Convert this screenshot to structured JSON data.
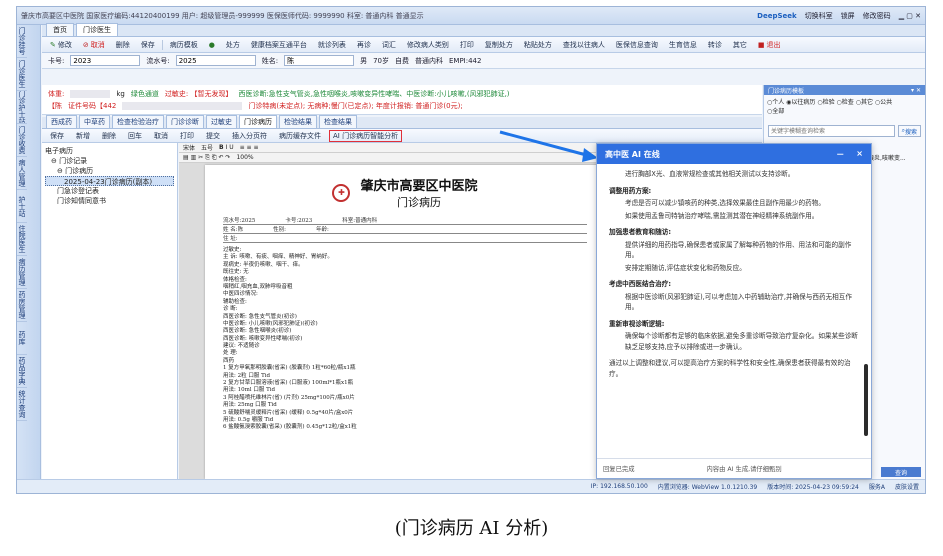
{
  "window": {
    "title": "肇庆市高要区中医院 国家医疗编码:44120400199 用户: 超级管理员-999999 医保医师代码: 9999990 科室: 普通内科  普通显示",
    "deepseek": "DeepSeek",
    "switch_dept": "切换科室",
    "lock": "锁屏",
    "change_pwd": "修改密码"
  },
  "left_rail": [
    "门诊挂号",
    "门诊医生",
    "门诊护士站",
    "门诊收费",
    "病人管理",
    "护士站",
    "住院医生",
    "病历管理",
    "药房管理",
    "药库",
    "药品字典",
    "统计查询"
  ],
  "top_tabs": [
    "首页",
    "门诊医生"
  ],
  "toolbar": [
    "修改",
    "取消",
    "删除",
    "保存",
    "病历模板",
    "保存",
    "处方",
    "健康档案互通平台",
    "就诊列表",
    "再诊",
    "词汇",
    "修改病人类别",
    "打印",
    "复制处方",
    "粘贴处方",
    "查找以往病人",
    "医保信息查询",
    "生育信息",
    "转诊",
    "其它",
    "退出"
  ],
  "row2": {
    "card_label": "卡号:",
    "card_value": "2023",
    "flow_label": "流水号:",
    "flow_value": "2025",
    "name_label": "姓名:",
    "name_value": "陈",
    "gender": "男",
    "age": "70岁",
    "fee_type": "自费",
    "category": "普通内科",
    "empi": "EMPI:442"
  },
  "info": {
    "weight_label": "体重:",
    "weight_unit": "kg",
    "green_channel": "绿色通道",
    "allergy": "过敏史: 【暂无发现】",
    "western_dx": "西医诊断:急性支气管炎,急性咽喉炎,咳嗽变异性哮喘、中医诊断:小儿咳嗽,(风邪犯肺证,)",
    "id_prefix": "【陈",
    "id_label": "证件号码【442",
    "special": "门诊特病(未定点); 无病种;慢门(已定点); 年度计报销: 普通门诊(0元);"
  },
  "subtabs": [
    "西成药",
    "中草药",
    "检查检验治疗",
    "门诊诊断",
    "过敏史",
    "门诊病历",
    "检验结果",
    "检查结果"
  ],
  "toolbar2": [
    "保存",
    "新增",
    "删除",
    "回车",
    "取消",
    "打印",
    "提交",
    "插入分页符",
    "病历缓存文件"
  ],
  "ai_button": "AI 门诊病历智能分析",
  "tree": [
    "电子病历",
    "门诊记录",
    "门诊病历",
    "2025-04-23门诊病历(副本)",
    "门急诊登记表",
    "门诊知情同意书"
  ],
  "editor": {
    "style": "宋体",
    "size": "五号",
    "zoom": "100%"
  },
  "paper": {
    "hospital": "肇庆市高要区中医院",
    "doc_title": "门诊病历",
    "flow_label": "流水号:2025",
    "card_label": "卡号:2023",
    "dept_label": "科室:普通内科",
    "name_label": "姓  名:陈",
    "gender_label": "性别:",
    "age_label": "年龄:",
    "addr_label": "住  址:",
    "lines": [
      "过敏史:",
      "主 诉: 咳嗽、有痰、咽痒、精神好、胃纳好。",
      "现病史: 半夜仍咳嗽、咽干、痒。",
      "既往史: 无",
      "体格检查:",
      "   咽稍红,咽充血,双肺呼吸音粗",
      "中医四诊情况:",
      "辅助检查:",
      "诊    断:",
      "   西医诊断: 急性支气管炎(初诊)",
      "   中医诊断: 小儿咳嗽(风邪犯肺证)(初诊)",
      "   西医诊断: 急性咽喉炎(初诊)",
      "   西医诊断: 咳嗽变异性哮喘(初诊)",
      "建议: 不适随诊",
      "处  理:",
      "      西药",
      "1 复方甲氧那明胶囊(省采) (胶囊剂) 1粒*60粒/瓶x1瓶",
      "   用法: 2粒 口服 Tid",
      "2 复方甘草口服溶液(省采) (口服液) 100ml*1瓶x1瓶",
      "   用法: 10ml 口服 Tid",
      "3 阿桂醋喷托维林片(省) (片剂) 25mg*100片/瓶x0片",
      "   用法: 25mg 口服 Tid",
      "5 硫酸舒喘灵缓释片(省采) (缓释) 0.5g*40片/盒x0片",
      "   用法: 0.5g 嚼服 Tid",
      "6 盐酸氨溴索胶囊(省采) (胶囊剂) 0.45g*12粒/盒x1粒"
    ]
  },
  "right_panel": {
    "head": "门诊病历模板",
    "radios": [
      "个人",
      "以往病历",
      "检验",
      "检查",
      "其它",
      "公共",
      "全部"
    ],
    "search_placeholder": "关键字模糊查询检索",
    "search_btn": "搜索",
    "list_title": "以往门诊病历一般",
    "list_item": "2025-04-23[急性支气管炎,急性咽喉炎,咳嗽变...",
    "bottom_tab": "查询"
  },
  "statusbar": {
    "ip": "IP: 192.168.50.100",
    "engine": "内置浏览器: WebView 1.0.1210.39",
    "version": "版本时间: 2025-04-23 09:59:24",
    "service": "服务A",
    "settings": "皮肤设置"
  },
  "ai_panel": {
    "title": "高中医 AI 在线",
    "min": "－",
    "close": "×",
    "line0": "进行胸部X光、血液常规检查或其他相关测试以支持诊断。",
    "sections": [
      {
        "h": "调整用药方案:",
        "p": [
          "考虑是否可以减少镇咳药的种类,选择效果最佳且副作用最少的药物。",
          "如果使用孟鲁司特钠治疗哮喘,需监测其潜在神经精神系统副作用。"
        ]
      },
      {
        "h": "加强患者教育和随访:",
        "p": [
          "提供详细的用药指导,确保患者或家属了解每种药物的作用、用法和可能的副作用。",
          "安排定期随访,评估症状变化和药物反应。"
        ]
      },
      {
        "h": "考虑中西医结合治疗:",
        "p": [
          "根据中医诊断(风邪犯肺证),可以考虑加入中药辅助治疗,并确保与西药无相互作用。"
        ]
      },
      {
        "h": "重新审视诊断逻辑:",
        "p": [
          "确保每个诊断都有足够的临床依据,避免多重诊断导致治疗复杂化。如果某些诊断缺乏足够支持,应予以排除或进一步确认。"
        ]
      }
    ],
    "conclusion": "通过以上调整和建议,可以提高治疗方案的科学性和安全性,确保患者获得最有效的治疗。",
    "foot_left": "回复已完成",
    "foot_mid": "内容由 AI 生成,请仔细甄别"
  },
  "caption": "(门诊病历 AI 分析)"
}
